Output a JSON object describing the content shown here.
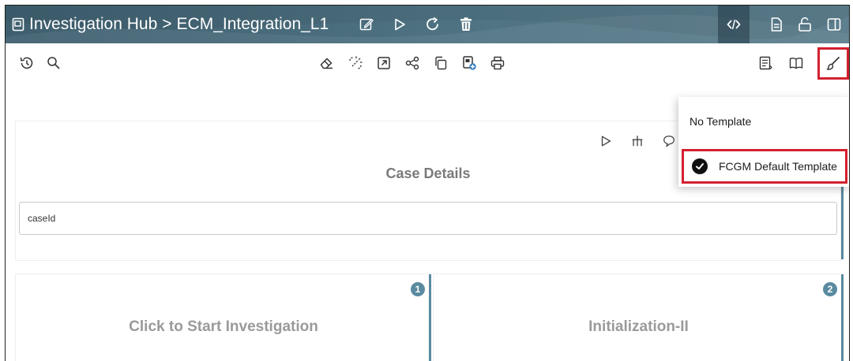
{
  "header": {
    "breadcrumb_root": "Investigation Hub",
    "separator": ">",
    "breadcrumb_current": "ECM_Integration_L1"
  },
  "case_details": {
    "title": "Case Details",
    "case_id_placeholder": "caseId"
  },
  "stages": [
    {
      "number": "1",
      "label": "Click to Start Investigation"
    },
    {
      "number": "2",
      "label": "Initialization-II"
    }
  ],
  "template_menu": {
    "items": [
      {
        "label": "No Template",
        "selected": false
      },
      {
        "label": "FCGM Default Template",
        "selected": true
      }
    ]
  },
  "colors": {
    "header_bg": "#4a6b7c",
    "accent": "#5a8aa0",
    "highlight": "#d3202f"
  },
  "icons": {
    "header": [
      "notebook-icon",
      "edit-icon",
      "play-icon",
      "refresh-icon",
      "delete-icon",
      "code-icon",
      "document-icon",
      "unlock-icon",
      "panel-icon"
    ],
    "toolbar": [
      "history-icon",
      "search-icon",
      "eraser-icon",
      "unlink-icon",
      "export-icon",
      "share-icon",
      "copy-icon",
      "add-notebook-icon",
      "print-icon",
      "summary-icon",
      "book-icon",
      "brush-icon"
    ],
    "case_panel": [
      "run-icon",
      "hierarchy-icon",
      "comment-icon"
    ]
  }
}
